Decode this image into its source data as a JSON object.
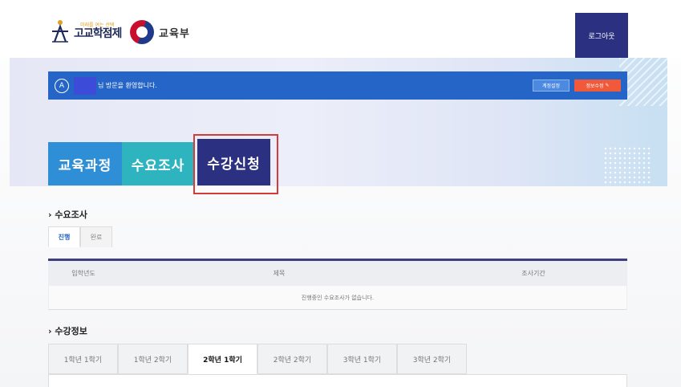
{
  "header": {
    "school_logo_small": "미래를 여는 선택",
    "school_logo_big": "고교학점제",
    "ministry_label": "교육부",
    "logout_label": "로그아웃"
  },
  "welcome": {
    "message": "님 방문을 환영합니다.",
    "mypage_label": "계정설정",
    "edit_label": "정보수정",
    "user_icon": "user-icon",
    "edit_icon": "pencil-icon"
  },
  "main_tabs": [
    {
      "label": "교육과정"
    },
    {
      "label": "수요조사"
    },
    {
      "label": "수강신청"
    }
  ],
  "survey": {
    "title": "수요조사",
    "tabs": [
      {
        "label": "진행"
      },
      {
        "label": "완료"
      }
    ],
    "columns": [
      "입학년도",
      "제목",
      "조사기간"
    ],
    "empty_message": "진행중인 수요조사가 없습니다."
  },
  "course_info": {
    "title": "수강정보",
    "terms": [
      {
        "label": "1학년 1학기"
      },
      {
        "label": "1학년 2학기"
      },
      {
        "label": "2학년 1학기"
      },
      {
        "label": "2학년 2학기"
      },
      {
        "label": "3학년 1학기"
      },
      {
        "label": "3학년 2학기"
      }
    ]
  },
  "colors": {
    "navy": "#2b3080",
    "blue": "#2565c7",
    "tab_blue": "#2f8fd6",
    "tab_teal": "#2eb4bf",
    "highlight_red": "#d43c3c",
    "edit_orange": "#f05a3a"
  }
}
